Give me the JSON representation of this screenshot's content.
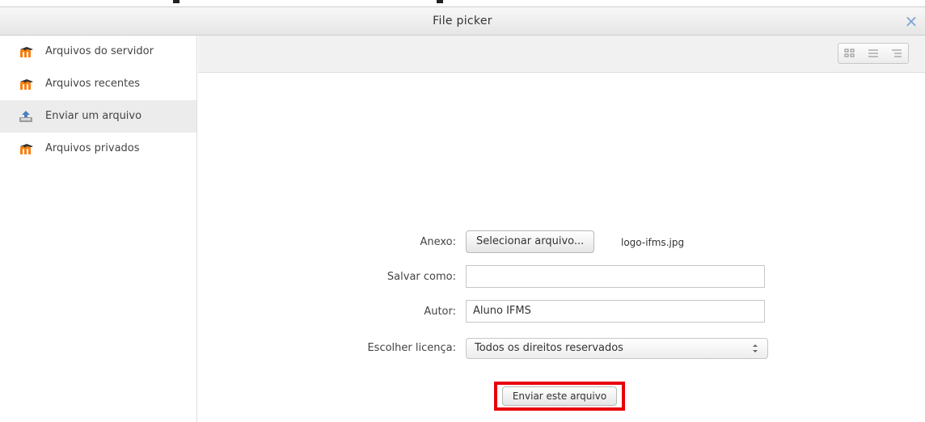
{
  "dialog": {
    "title": "File picker",
    "close_symbol": "×"
  },
  "sidebar": {
    "items": [
      {
        "label": "Arquivos do servidor",
        "icon": "moodle-icon",
        "active": false
      },
      {
        "label": "Arquivos recentes",
        "icon": "moodle-icon",
        "active": false
      },
      {
        "label": "Enviar um arquivo",
        "icon": "upload-icon",
        "active": true
      },
      {
        "label": "Arquivos privados",
        "icon": "moodle-icon",
        "active": false
      }
    ]
  },
  "toolbar": {
    "views": [
      "icons-view-icon",
      "list-view-icon",
      "tree-view-icon"
    ]
  },
  "form": {
    "attachment": {
      "label": "Anexo:",
      "button": "Selecionar arquivo...",
      "filename": "logo-ifms.jpg"
    },
    "save_as": {
      "label": "Salvar como:",
      "value": ""
    },
    "author": {
      "label": "Autor:",
      "value": "Aluno IFMS"
    },
    "license": {
      "label": "Escolher licença:",
      "selected": "Todos os direitos reservados"
    },
    "submit_label": "Enviar este arquivo"
  },
  "colors": {
    "highlight": "#e8000b",
    "moodle_orange": "#f98012",
    "close_blue": "#7aa0d6"
  }
}
